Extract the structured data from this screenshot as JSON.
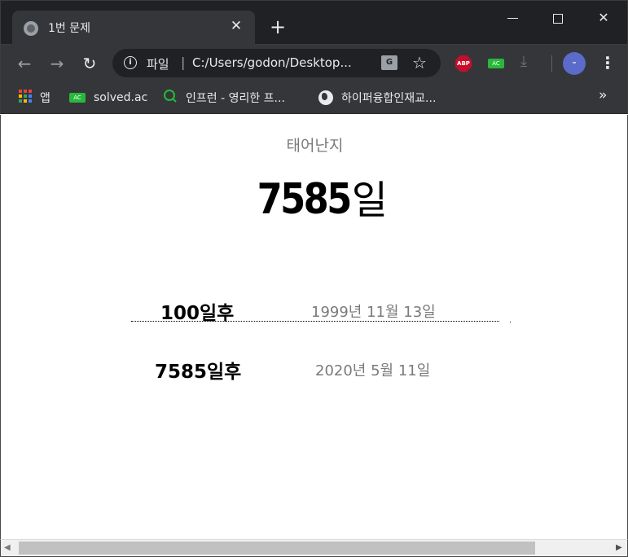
{
  "browser": {
    "tab_title": "1번 문제",
    "tab_close": "✕",
    "new_tab": "+",
    "window": {
      "minimize": "",
      "maximize": "",
      "close": "✕"
    },
    "toolbar": {
      "back": "←",
      "forward": "→",
      "reload": "↻",
      "info": "i",
      "scheme": "파일",
      "separator": "|",
      "url": "C:/Users/godon/Desktop...",
      "translate": "G",
      "star": "☆",
      "abp": "ABP",
      "ac_ext": "AC",
      "download": "⤓",
      "profile": "-",
      "menu": "⋮"
    },
    "bookmarks": [
      {
        "label": "앱",
        "icon": "apps-grid-icon"
      },
      {
        "label": "solved.ac",
        "icon": "ac-icon",
        "icon_text": "AC"
      },
      {
        "label": "인프런 - 영리한 프...",
        "icon": "inflearn-icon"
      },
      {
        "label": "하이퍼융합인재교...",
        "icon": "globe-icon"
      }
    ],
    "bookmarks_more": "»"
  },
  "content": {
    "subtitle": "태어난지",
    "days_number": "7585",
    "days_unit": "일",
    "rows": [
      {
        "label": "100일후",
        "date": "1999년 11월 13일"
      },
      {
        "label": "7585일후",
        "date": "2020년 5월 11일"
      }
    ]
  },
  "scrollbar": {
    "left_arrow": "◀",
    "right_arrow": "▶"
  },
  "colors": {
    "titlebar": "#202124",
    "toolbar": "#35363a",
    "profile": "#5b6bc9",
    "abp": "#c70d2c",
    "ac_green": "#28b83a",
    "muted_text": "#7a7a7a"
  }
}
